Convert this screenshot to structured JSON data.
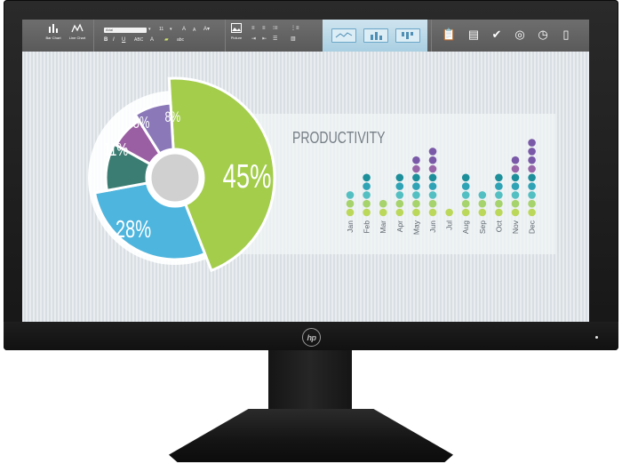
{
  "device": {
    "logo_text": "hp"
  },
  "toolbar": {
    "chart_buttons": [
      {
        "label": "Bar Chart",
        "icon": "bar-chart-icon"
      },
      {
        "label": "Line Chart",
        "icon": "line-chart-icon"
      }
    ],
    "font_name": "Arial",
    "font_size": "11",
    "format_buttons": [
      "B",
      "I",
      "U",
      "ABC",
      "A",
      "abc"
    ],
    "grow_font": "A",
    "shrink_font": "A",
    "picture_label": "Picture",
    "chart_type_tabs": [
      "line-chart-tab",
      "bar-chart-tab",
      "column-chart-tab"
    ],
    "right_icons": [
      "clipboard-check-icon",
      "clipboard-icon",
      "checkmark-icon",
      "target-icon",
      "clock-icon",
      "panel-icon"
    ]
  },
  "pie": {
    "segments": [
      {
        "label": "45%",
        "value": 45,
        "color": "#a3cd4b"
      },
      {
        "label": "28%",
        "value": 28,
        "color": "#4eb5de"
      },
      {
        "label": "11%",
        "value": 11,
        "color": "#3b7d72"
      },
      {
        "label": "8%",
        "value": 8,
        "color": "#9a5ea3"
      },
      {
        "label": "8%",
        "value": 8,
        "color": "#8a78b8"
      }
    ]
  },
  "productivity": {
    "title": "PRODUCTIVITY",
    "dot_colors": [
      "#bcd85a",
      "#a6d36b",
      "#54bfc2",
      "#2fa3b6",
      "#1c8f9a",
      "#9866a8",
      "#7a5aa8"
    ]
  },
  "chart_data": {
    "type": "scatter",
    "title": "PRODUCTIVITY",
    "categories": [
      "Jan",
      "Feb",
      "Mar",
      "Apr",
      "May",
      "Jun",
      "Jul",
      "Aug",
      "Sep",
      "Oct",
      "Nov",
      "Dec"
    ],
    "values": [
      3,
      5,
      2,
      5,
      7,
      8,
      1,
      5,
      3,
      5,
      7,
      9
    ],
    "xlabel": "",
    "ylabel": ""
  }
}
